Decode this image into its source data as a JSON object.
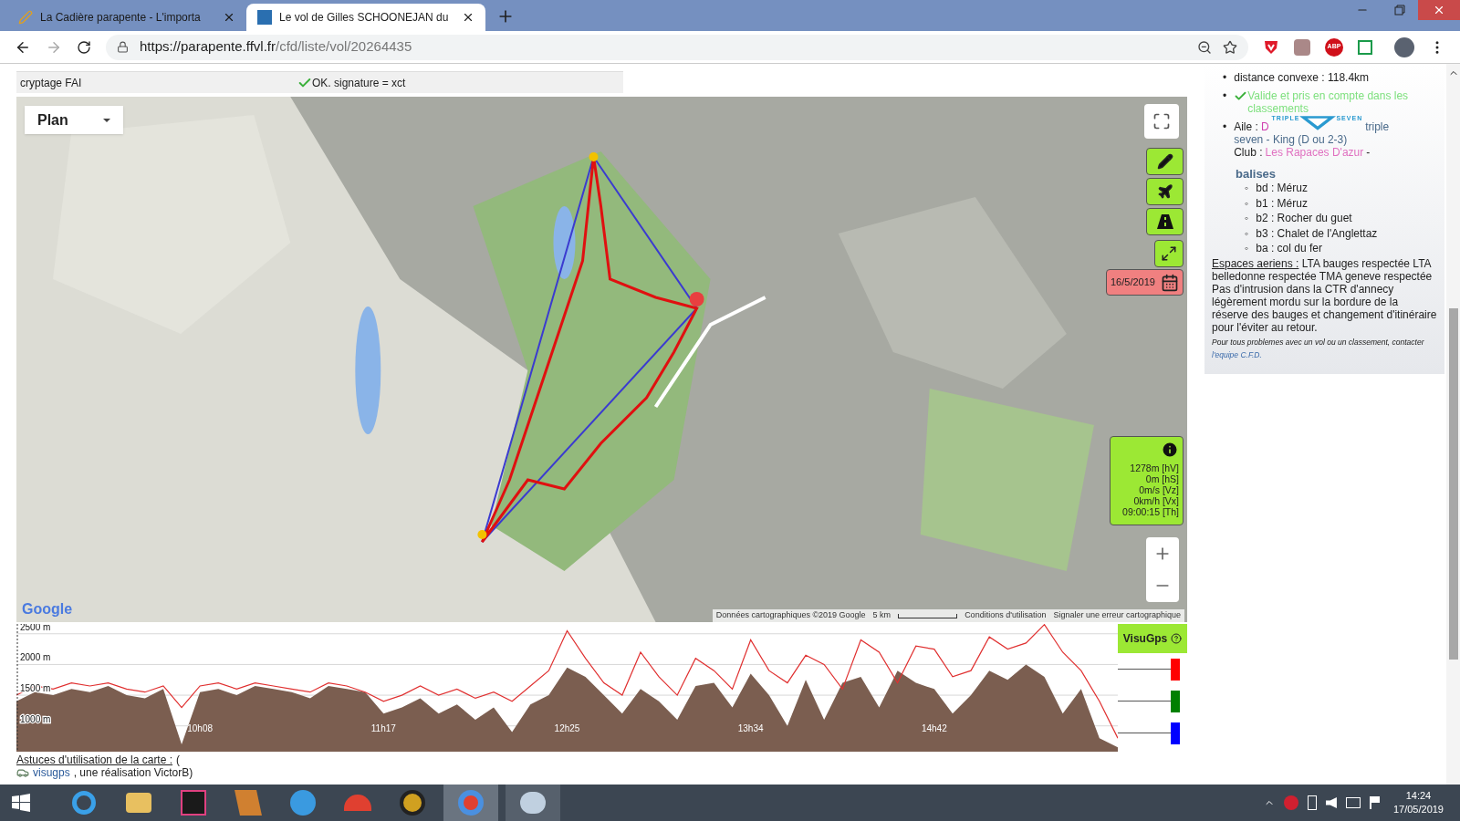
{
  "browser": {
    "tabs": [
      {
        "title": "La Cadière parapente - L'importa",
        "selected": false
      },
      {
        "title": "Le vol de Gilles SCHOONEJAN du",
        "selected": true
      }
    ],
    "url_host": "https://parapente.ffvl.fr",
    "url_path": "/cfd/liste/vol/20264435",
    "extension_badge": "ABP"
  },
  "info_table": {
    "rows": [
      {
        "label": "cryptage FAI",
        "value": "OK. signature = xct"
      }
    ]
  },
  "map": {
    "layer_select": "Plan",
    "date": "16/5/2019",
    "readout": [
      "1278m [hV]",
      "0m [hS]",
      "0m/s [Vz]",
      "0km/h [Vx]",
      "09:00:15 [Th]"
    ],
    "logo": "Google",
    "attribution": "Données cartographiques ©2019 Google",
    "scale": "5 km",
    "terms": "Conditions d'utilisation",
    "report": "Signaler une erreur cartographique"
  },
  "elevation": {
    "chart_data": {
      "type": "area",
      "categories": [
        null,
        null,
        null,
        null,
        null,
        null,
        null,
        null,
        null,
        null,
        "10h08",
        null,
        null,
        null,
        null,
        null,
        null,
        null,
        null,
        null,
        "11h17",
        null,
        null,
        null,
        null,
        null,
        null,
        null,
        null,
        null,
        "12h25",
        null,
        null,
        null,
        null,
        null,
        null,
        null,
        null,
        null,
        "13h34",
        null,
        null,
        null,
        null,
        null,
        null,
        null,
        null,
        null,
        "14h42",
        null,
        null,
        null,
        null,
        null,
        null,
        null,
        null,
        null,
        null
      ],
      "series": [
        {
          "type": "area",
          "color": "#7b5e50",
          "values": [
            1400,
            1550,
            1500,
            1600,
            1550,
            1650,
            1500,
            1450,
            1600,
            700,
            1550,
            1600,
            1500,
            1650,
            1600,
            1550,
            1450,
            1650,
            1600,
            1550,
            1200,
            1300,
            1450,
            1200,
            1350,
            1100,
            1300,
            900,
            1350,
            1500,
            1950,
            1800,
            1500,
            1200,
            1600,
            1400,
            1100,
            1650,
            1700,
            1300,
            1850,
            1500,
            1000,
            1750,
            1100,
            1700,
            1800,
            1300,
            1900,
            1700,
            1600,
            1200,
            1500,
            1900,
            1750,
            2000,
            1800,
            1200,
            1600,
            800,
            650
          ]
        },
        {
          "type": "line",
          "color": "#e03030",
          "values": [
            1500,
            1650,
            1600,
            1700,
            1650,
            1700,
            1600,
            1550,
            1650,
            1300,
            1650,
            1700,
            1600,
            1700,
            1650,
            1600,
            1550,
            1700,
            1650,
            1550,
            1400,
            1500,
            1650,
            1500,
            1600,
            1450,
            1550,
            1400,
            1650,
            1900,
            2550,
            2100,
            1700,
            1500,
            2200,
            1800,
            1500,
            2100,
            1900,
            1600,
            2400,
            1900,
            1700,
            2150,
            2000,
            1600,
            2400,
            2200,
            1700,
            2300,
            2250,
            1800,
            1900,
            2450,
            2250,
            2350,
            2650,
            2200,
            1900,
            1400,
            800
          ]
        }
      ],
      "ylim": [
        580,
        2660
      ],
      "grid": true,
      "yticks": [
        {
          "value": 1000,
          "label": "1000 m"
        },
        {
          "value": 1500,
          "label": "1500 m"
        },
        {
          "value": 2000,
          "label": "2000 m"
        },
        {
          "value": 2500,
          "label": "2500 m"
        }
      ]
    },
    "visugps": "VisuGps",
    "channels": [
      {
        "color": "#ff0000"
      },
      {
        "color": "#008000"
      },
      {
        "color": "#0000ff"
      }
    ]
  },
  "footer": {
    "tips": "Astuces d'utilisation de la carte :",
    "paren": "(",
    "link": "visugps",
    "credit": ", une réalisation VictorB)"
  },
  "flight_info": {
    "bullet": "•",
    "sub_bullet": "◦",
    "distance": "distance convexe : 118.4km",
    "validation": "Valide et pris en compte dans les classements",
    "wing": {
      "label": "Aile :",
      "class": "D",
      "logo_left": "TRIPLE",
      "logo_right": "SEVEN",
      "name_1": "triple",
      "name_2": "seven - King (D ou 2-3)"
    },
    "club": {
      "label": "Club :",
      "name": "Les Rapaces D'azur",
      "suffix": "-"
    },
    "beacons_title": "balises",
    "beacons": [
      "bd : Méruz",
      "b1 : Méruz",
      "b2 : Rocher du guet",
      "b3 : Chalet de l'Anglettaz",
      "ba : col du fer"
    ],
    "airspace_label": "Espaces aeriens :",
    "airspace_text": "LTA bauges respectée LTA belledonne respectée TMA geneve respectée Pas d'intrusion dans la CTR d'annecy légèrement mordu sur la bordure de la réserve des bauges et changement d'itinéraire pour l'éviter au retour.",
    "contact_text": "Pour tous problemes avec un vol ou un classement, contacter",
    "contact_link": "l'equipe C.F.D."
  },
  "taskbar": {
    "time": "14:24",
    "date": "17/05/2019"
  }
}
